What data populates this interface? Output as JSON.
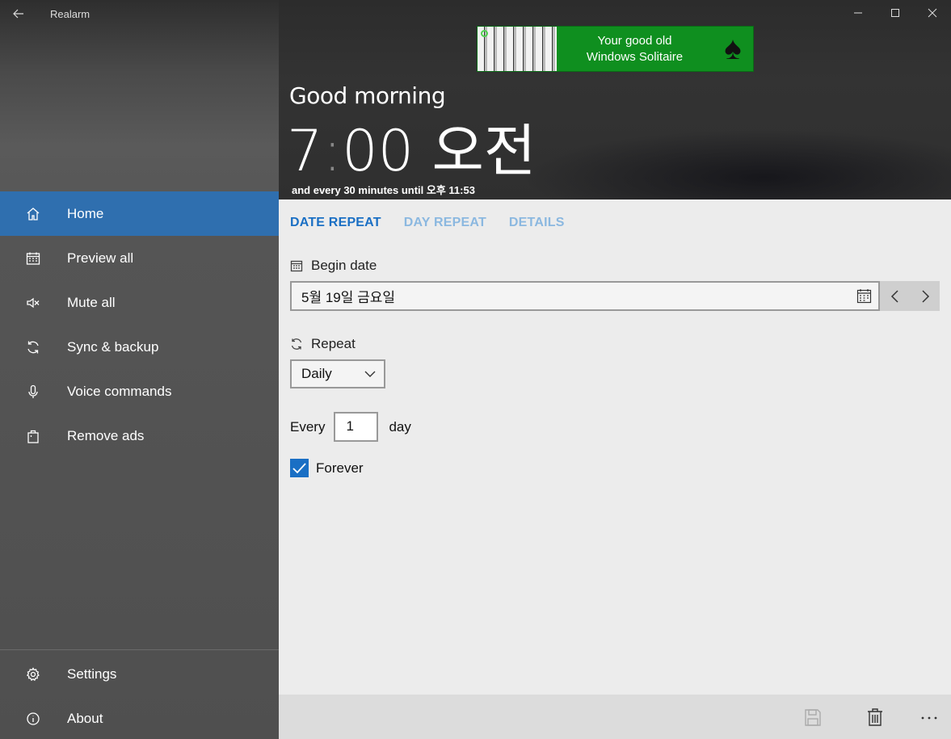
{
  "app": {
    "title": "Realarm"
  },
  "window": {
    "back": "←"
  },
  "sidebar": {
    "items": [
      {
        "label": "Home",
        "icon": "home-icon"
      },
      {
        "label": "Preview all",
        "icon": "calendar-icon"
      },
      {
        "label": "Mute all",
        "icon": "mute-icon"
      },
      {
        "label": "Sync & backup",
        "icon": "sync-icon"
      },
      {
        "label": "Voice commands",
        "icon": "microphone-icon"
      },
      {
        "label": "Remove ads",
        "icon": "bag-icon"
      }
    ],
    "bottom": [
      {
        "label": "Settings",
        "icon": "gear-icon"
      },
      {
        "label": "About",
        "icon": "info-icon"
      }
    ]
  },
  "ad": {
    "line1": "Your good old",
    "line2": "Windows Solitaire"
  },
  "hero": {
    "greeting": "Good morning",
    "hour": "7",
    "colon": ":",
    "minutes": "00",
    "ampm": "오전",
    "subtitle": "and every 30 minutes until 오후 11:53"
  },
  "tabs": [
    "DATE REPEAT",
    "DAY REPEAT",
    "DETAILS"
  ],
  "form": {
    "begin_date_label": "Begin date",
    "begin_date_value": "5월 19일 금요일",
    "repeat_label": "Repeat",
    "repeat_value": "Daily",
    "every_label": "Every",
    "every_value": "1",
    "unit_label": "day",
    "forever_label": "Forever",
    "forever_checked": true
  },
  "colors": {
    "accent": "#1a6fc4",
    "nav_active": "#2f6faf",
    "ad_green": "#0f8f1f"
  }
}
